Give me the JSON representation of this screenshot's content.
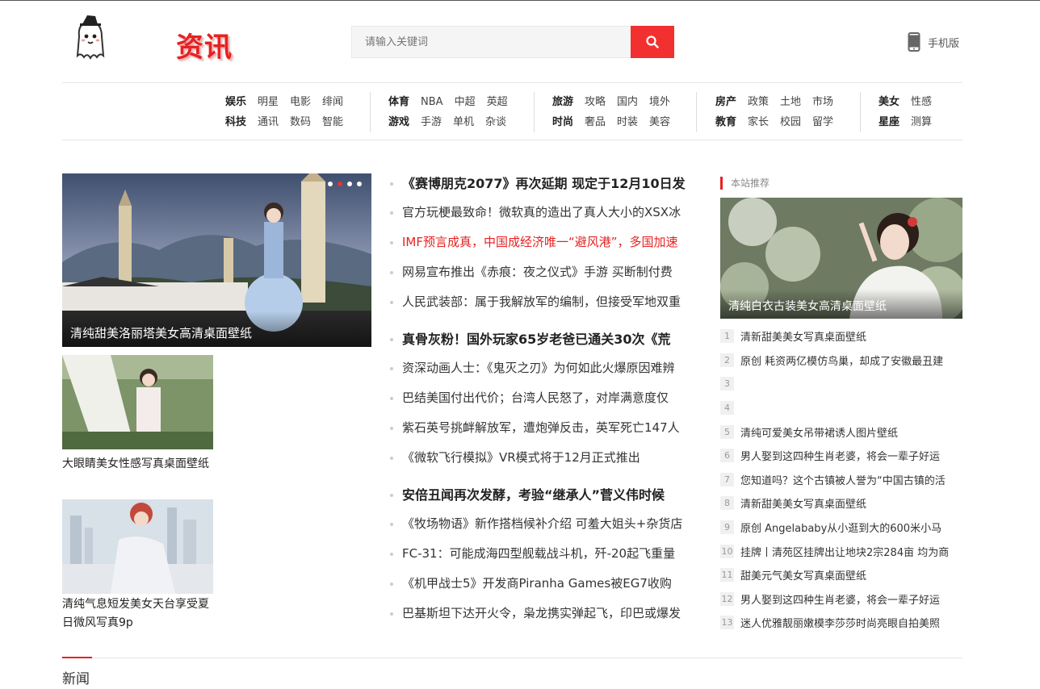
{
  "header": {
    "logo_text": "资讯",
    "search_placeholder": "请输入关键词",
    "mobile_label": "手机版"
  },
  "nav": [
    {
      "rows": [
        [
          "娱乐",
          "明星",
          "电影",
          "绯闻"
        ],
        [
          "科技",
          "通讯",
          "数码",
          "智能"
        ]
      ]
    },
    {
      "rows": [
        [
          "体育",
          "NBA",
          "中超",
          "英超"
        ],
        [
          "游戏",
          "手游",
          "单机",
          "杂谈"
        ]
      ]
    },
    {
      "rows": [
        [
          "旅游",
          "攻略",
          "国内",
          "境外"
        ],
        [
          "时尚",
          "奢品",
          "时装",
          "美容"
        ]
      ]
    },
    {
      "rows": [
        [
          "房产",
          "政策",
          "土地",
          "市场"
        ],
        [
          "教育",
          "家长",
          "校园",
          "留学"
        ]
      ]
    },
    {
      "rows": [
        [
          "美女",
          "性感"
        ],
        [
          "星座",
          "测算"
        ]
      ]
    }
  ],
  "slider": {
    "caption": "清纯甜美洛丽塔美女高清桌面壁纸",
    "dots": 4,
    "active_dot": 2
  },
  "thumbs": [
    {
      "title": "大眼睛美女性感写真桌面壁纸"
    },
    {
      "title": "清纯气息短发美女天台享受夏日微风写真9p"
    }
  ],
  "news_blocks": [
    {
      "headline": "《赛博朋克2077》再次延期 现定于12月10日发",
      "items": [
        {
          "text": "官方玩梗最致命！微软真的造出了真人大小的XSX冰",
          "red": false
        },
        {
          "text": "IMF预言成真，中国成经济唯一“避风港”，多国加速",
          "red": true
        },
        {
          "text": "网易宣布推出《赤痕：夜之仪式》手游 买断制付费",
          "red": false
        },
        {
          "text": "人民武装部：属于我解放军的编制，但接受军地双重",
          "red": false
        }
      ]
    },
    {
      "headline": "真骨灰粉！国外玩家65岁老爸已通关30次《荒",
      "items": [
        {
          "text": "资深动画人士：《鬼灭之刃》为何如此火爆原因难辨",
          "red": false
        },
        {
          "text": "巴结美国付出代价；台湾人民怒了，对岸满意度仅",
          "red": false
        },
        {
          "text": "紫石英号挑衅解放军，遭炮弹反击，英军死亡147人",
          "red": false
        },
        {
          "text": "《微软飞行模拟》VR模式将于12月正式推出",
          "red": false
        }
      ]
    },
    {
      "headline": "安倍丑闻再次发酵，考验“继承人”菅义伟时候",
      "items": [
        {
          "text": "《牧场物语》新作搭档候补介绍 可羞大姐头+杂货店",
          "red": false
        },
        {
          "text": "FC-31：可能成海四型舰载战斗机，歼-20起飞重量",
          "red": false
        },
        {
          "text": "《机甲战士5》开发商Piranha Games被EG7收购",
          "red": false
        },
        {
          "text": "巴基斯坦下达开火令，枭龙携实弹起飞，印巴或爆发",
          "red": false
        }
      ]
    }
  ],
  "recommend": {
    "title": "本站推荐",
    "image_caption": "清纯白衣古装美女高清桌面壁纸",
    "list": [
      {
        "num": "1",
        "text": "清新甜美美女写真桌面壁纸"
      },
      {
        "num": "2",
        "text": "原创 耗资两亿模仿鸟巢，却成了安徽最丑建"
      },
      {
        "num": "3",
        "text": ""
      },
      {
        "num": "4",
        "text": ""
      },
      {
        "num": "5",
        "text": "清纯可爱美女吊带裙诱人图片壁纸"
      },
      {
        "num": "6",
        "text": "男人娶到这四种生肖老婆，将会一辈子好运"
      },
      {
        "num": "7",
        "text": "您知道吗？这个古镇被人誉为“中国古镇的活"
      },
      {
        "num": "8",
        "text": "清新甜美美女写真桌面壁纸"
      },
      {
        "num": "9",
        "text": "原创 Angelababy从小逛到大的600米小马"
      },
      {
        "num": "10",
        "text": "挂牌丨清苑区挂牌出让地块2宗284亩 均为商"
      },
      {
        "num": "11",
        "text": "甜美元气美女写真桌面壁纸"
      },
      {
        "num": "12",
        "text": "男人娶到这四种生肖老婆，将会一辈子好运"
      },
      {
        "num": "13",
        "text": "迷人优雅靓丽嫩模李莎莎时尚亮眼自拍美照"
      }
    ]
  },
  "section": {
    "title": "新闻"
  },
  "colors": {
    "accent": "#e52222",
    "search_button": "#f23030"
  }
}
